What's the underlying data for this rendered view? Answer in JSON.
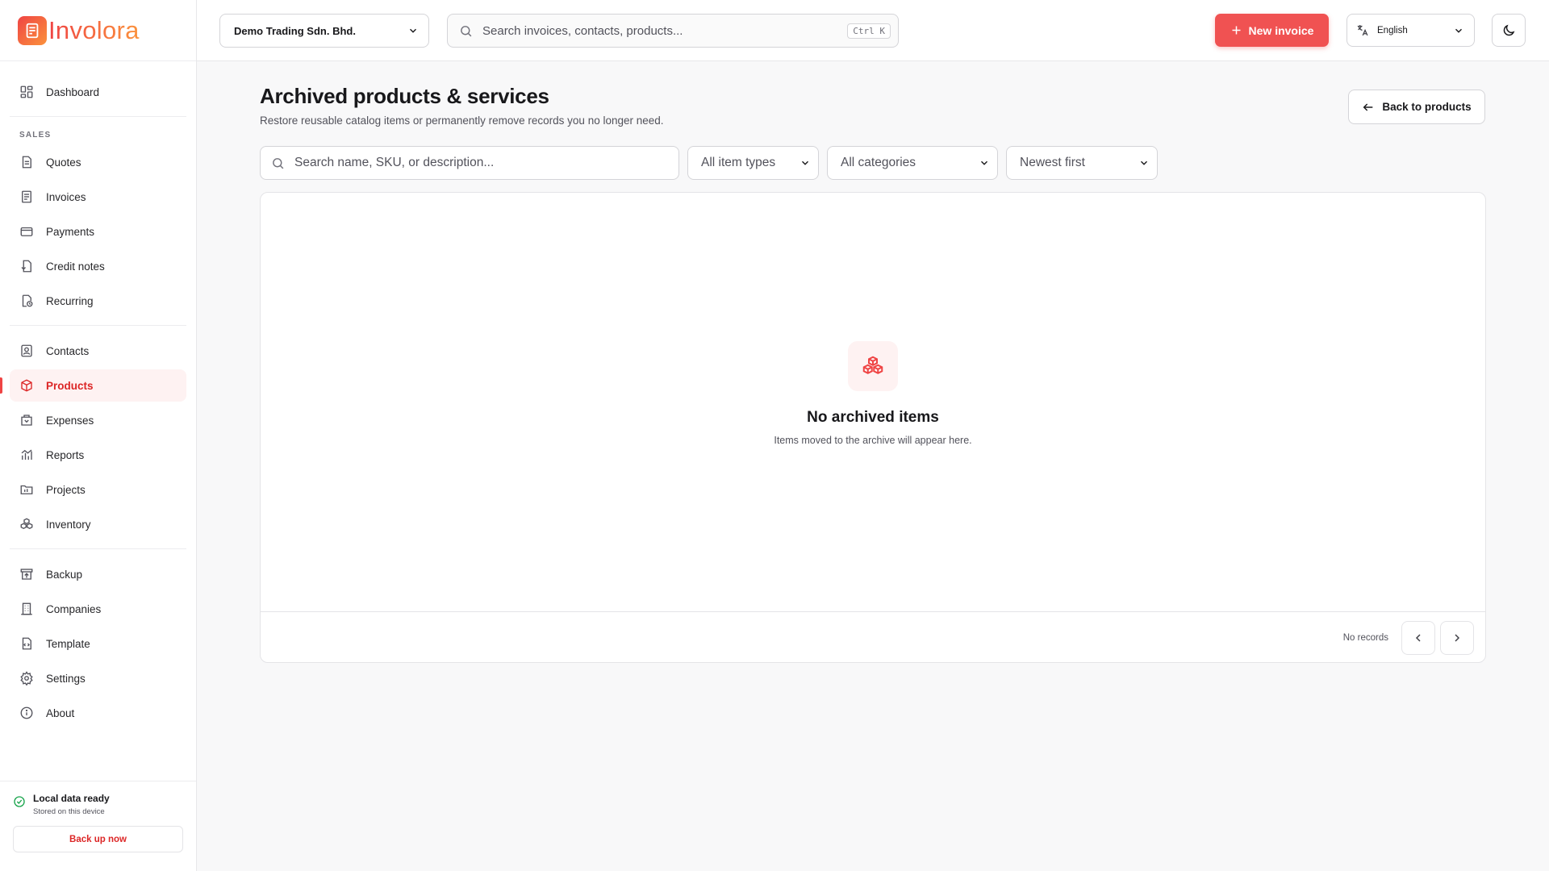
{
  "brand": {
    "name": "Involora"
  },
  "sidebar": {
    "top_items": [
      {
        "label": "Dashboard",
        "icon": "dashboard-icon"
      }
    ],
    "section_label": "SALES",
    "sales_items": [
      {
        "label": "Quotes",
        "icon": "quote-icon"
      },
      {
        "label": "Invoices",
        "icon": "invoice-icon"
      },
      {
        "label": "Payments",
        "icon": "card-icon"
      },
      {
        "label": "Credit notes",
        "icon": "credit-note-icon"
      },
      {
        "label": "Recurring",
        "icon": "recurring-icon"
      }
    ],
    "main_items": [
      {
        "label": "Contacts",
        "icon": "contact-icon"
      },
      {
        "label": "Products",
        "icon": "product-icon",
        "active": true
      },
      {
        "label": "Expenses",
        "icon": "expense-icon"
      },
      {
        "label": "Reports",
        "icon": "chart-icon"
      },
      {
        "label": "Projects",
        "icon": "folder-icon"
      },
      {
        "label": "Inventory",
        "icon": "boxes-icon"
      }
    ],
    "system_items": [
      {
        "label": "Backup",
        "icon": "archive-icon"
      },
      {
        "label": "Companies",
        "icon": "building-icon"
      },
      {
        "label": "Template",
        "icon": "template-icon"
      },
      {
        "label": "Settings",
        "icon": "gear-icon"
      },
      {
        "label": "About",
        "icon": "info-icon"
      }
    ],
    "footer": {
      "status_title": "Local data ready",
      "status_sub": "Stored on this device",
      "backup_label": "Back up now"
    }
  },
  "topbar": {
    "company": "Demo Trading Sdn. Bhd.",
    "search_placeholder": "Search invoices, contacts, products...",
    "search_shortcut": "Ctrl K",
    "new_invoice_label": "New invoice",
    "language": "English"
  },
  "main": {
    "title": "Archived products & services",
    "subtitle": "Restore reusable catalog items or permanently remove records you no longer need.",
    "back_label": "Back to products",
    "filters": {
      "search_placeholder": "Search name, SKU, or description...",
      "item_type": "All item types",
      "category": "All categories",
      "sort": "Newest first"
    },
    "empty": {
      "title": "No archived items",
      "subtitle": "Items moved to the archive will appear here."
    },
    "pagination": {
      "records_label": "No records"
    }
  },
  "colors": {
    "accent": "#f05252",
    "active_bg": "#fef2f2",
    "active_text": "#dc2626"
  }
}
